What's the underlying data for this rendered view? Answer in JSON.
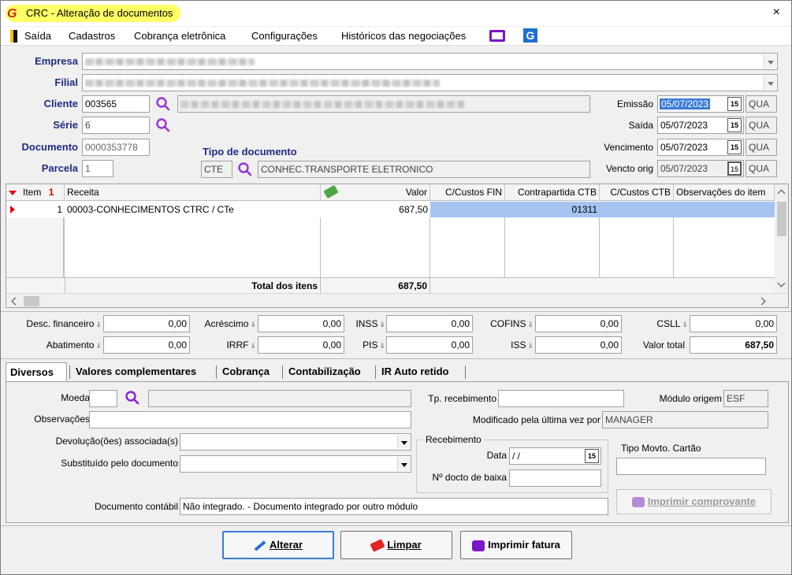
{
  "window": {
    "title": "CRC - Alteração de documentos",
    "close_label": "×"
  },
  "menu": {
    "items": [
      "Saída",
      "Cadastros",
      "Cobrança eletrônica",
      "Configurações",
      "Históricos das negociações"
    ]
  },
  "header": {
    "empresa_label": "Empresa",
    "filial_label": "Filial",
    "cliente_label": "Cliente",
    "cliente_code": "003565",
    "serie_label": "Série",
    "serie_value": "6",
    "documento_label": "Documento",
    "documento_value": "0000353778",
    "parcela_label": "Parcela",
    "parcela_value": "1",
    "tipo_doc_label": "Tipo de documento",
    "tipo_doc_code": "CTE",
    "tipo_doc_desc": "CONHEC.TRANSPORTE ELETRONICO"
  },
  "dates": [
    {
      "label": "Emissão",
      "value": "05/07/2023",
      "weekday": "QUA"
    },
    {
      "label": "Saída",
      "value": "05/07/2023",
      "weekday": "QUA"
    },
    {
      "label": "Vencimento",
      "value": "05/07/2023",
      "weekday": "QUA"
    },
    {
      "label": "Vencto orig",
      "value": "05/07/2023",
      "weekday": "QUA"
    }
  ],
  "grid": {
    "columns": [
      "Item",
      "Receita",
      "Valor",
      "C/Custos FIN",
      "Contrapartida CTB",
      "C/Custos CTB",
      "Observações do item"
    ],
    "sort_marker": "1",
    "rows": [
      {
        "item": "1",
        "receita": "00003-CONHECIMENTOS CTRC / CTe",
        "valor": "687,50",
        "cc_fin": "",
        "contrapartida": "01311",
        "cc_ctb": "",
        "obs": ""
      }
    ],
    "total_label": "Total dos itens",
    "total_value": "687,50"
  },
  "amounts": {
    "desc_financeiro": {
      "label": "Desc. financeiro",
      "value": "0,00"
    },
    "acrescimo": {
      "label": "Acréscimo",
      "value": "0,00"
    },
    "inss": {
      "label": "INSS",
      "value": "0,00"
    },
    "cofins": {
      "label": "COFINS",
      "value": "0,00"
    },
    "csll": {
      "label": "CSLL",
      "value": "0,00"
    },
    "abatimento": {
      "label": "Abatimento",
      "value": "0,00"
    },
    "irrf": {
      "label": "IRRF",
      "value": "0,00"
    },
    "pis": {
      "label": "PIS",
      "value": "0,00"
    },
    "iss": {
      "label": "ISS",
      "value": "0,00"
    },
    "valor_total": {
      "label": "Valor total",
      "value": "687,50"
    }
  },
  "tabs": [
    "Diversos",
    "Valores complementares",
    "Cobrança",
    "Contabilização",
    "IR Auto retido"
  ],
  "diversos": {
    "moeda_label": "Moeda",
    "observacoes_label": "Observações",
    "devolucoes_label": "Devolução(ões) associada(s)",
    "substituido_label": "Substituído pelo documento",
    "documento_contabil_label": "Documento contábil",
    "documento_contabil_value": "Não integrado.  - Documento integrado por outro módulo",
    "tp_recebimento_label": "Tp. recebimento",
    "modulo_origem_label": "Módulo origem",
    "modulo_origem_value": "ESF",
    "modificado_label": "Modificado pela última vez por",
    "modificado_value": "MANAGER",
    "recebimento_group": "Recebimento",
    "data_label": "Data",
    "data_value": " /  /",
    "docto_baixa_label": "Nº docto de baixa",
    "tipo_movto_label": "Tipo Movto. Cartão",
    "imprimir_comprovante": "Imprimir comprovante"
  },
  "buttons": {
    "alterar": "Alterar",
    "limpar": "Limpar",
    "imprimir_fatura": "Imprimir fatura"
  }
}
